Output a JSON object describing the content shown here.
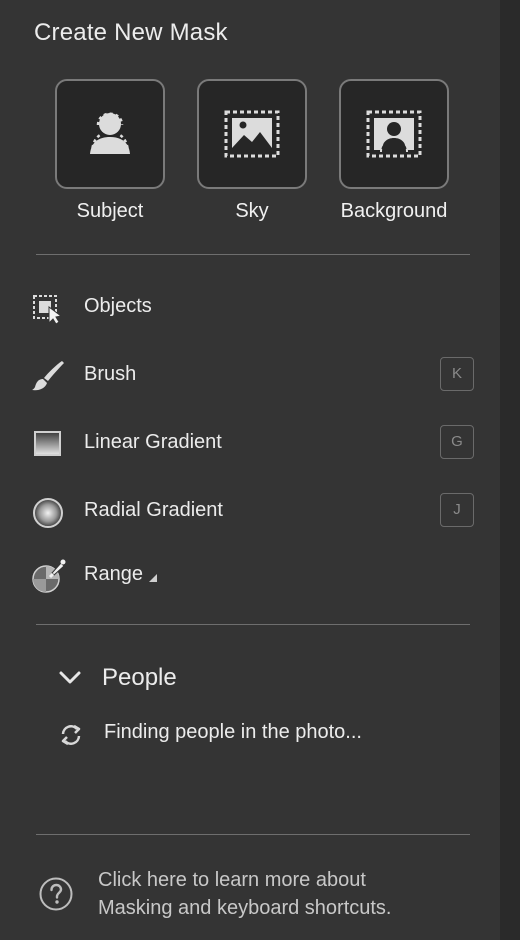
{
  "panel": {
    "title": "Create New Mask"
  },
  "mask_types": [
    {
      "label": "Subject",
      "icon": "subject-icon"
    },
    {
      "label": "Sky",
      "icon": "sky-icon"
    },
    {
      "label": "Background",
      "icon": "background-icon"
    }
  ],
  "tools": [
    {
      "label": "Objects",
      "icon": "objects-icon",
      "shortcut": ""
    },
    {
      "label": "Brush",
      "icon": "brush-icon",
      "shortcut": "K"
    },
    {
      "label": "Linear Gradient",
      "icon": "linear-gradient-icon",
      "shortcut": "G"
    },
    {
      "label": "Radial Gradient",
      "icon": "radial-gradient-icon",
      "shortcut": "J"
    },
    {
      "label": "Range",
      "icon": "range-icon",
      "shortcut": "",
      "has_submenu": true
    }
  ],
  "people": {
    "title": "People",
    "expanded": true,
    "status": "Finding people in the photo..."
  },
  "help": {
    "line1": "Click here to learn more about",
    "line2": "Masking and keyboard shortcuts."
  },
  "colors": {
    "panel_bg": "#343434",
    "button_bg": "#262626",
    "button_border": "#7a7a7a",
    "text": "#ececec",
    "shortcut_text": "#8a8a8a"
  }
}
